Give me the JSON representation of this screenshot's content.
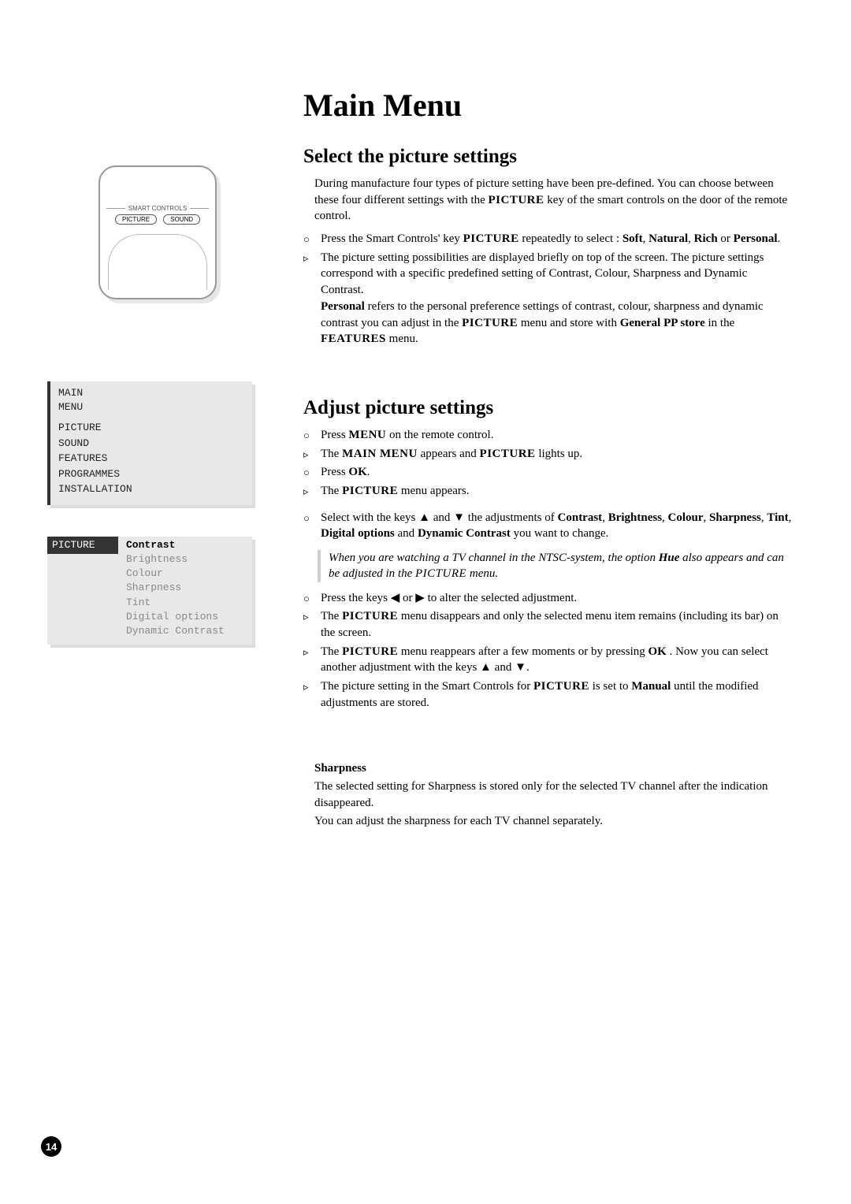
{
  "page_number": "14",
  "title": "Main Menu",
  "remote": {
    "smart_controls_label": "SMART CONTROLS",
    "btn_picture": "PICTURE",
    "btn_sound": "SOUND"
  },
  "osd_main": {
    "title_line1": "MAIN",
    "title_line2": "MENU",
    "items": [
      "PICTURE",
      "SOUND",
      "FEATURES",
      "PROGRAMMES",
      "INSTALLATION"
    ]
  },
  "osd_picture": {
    "left_label": "PICTURE",
    "items": [
      "Contrast",
      "Brightness",
      "Colour",
      "Sharpness",
      "Tint",
      "Digital options",
      "Dynamic Contrast"
    ]
  },
  "sec1": {
    "heading": "Select the picture settings",
    "intro": "During manufacture four types of picture setting have been pre-defined. You can choose between these four different settings with the ",
    "intro_key": "PICTURE",
    "intro_end": " key of the smart controls on the door of the remote control.",
    "b1_a": "Press the Smart Controls' key ",
    "b1_key": "PICTURE",
    "b1_b": " repeatedly to select :  ",
    "b1_soft": "Soft",
    "b1_sep1": ", ",
    "b1_nat": "Natural",
    "b1_sep2": ", ",
    "b1_rich": "Rich",
    "b1_or": " or ",
    "b1_pers": "Personal",
    "b1_end": ".",
    "b2": "The picture setting possibilities are displayed briefly on top of the screen. The picture settings correspond with a specific predefined setting of Contrast, Colour, Sharpness and Dynamic Contrast.",
    "b2b_pers": "Personal",
    "b2b_rest": " refers to the personal preference settings of contrast, colour, sharpness and dynamic contrast you can adjust in the ",
    "b2b_key": "PICTURE",
    "b2b_mid": " menu and store with ",
    "b2b_gpp": "General PP store",
    "b2b_in": " in the ",
    "b2b_feat": "FEATURES",
    "b2b_end": " menu."
  },
  "sec2": {
    "heading": "Adjust picture settings",
    "s1a": "Press ",
    "s1_menu": "MENU",
    "s1b": " on the remote control.",
    "s2a": "The ",
    "s2_mm": "MAIN MENU",
    "s2b": " appears and ",
    "s2_pic": "PICTURE",
    "s2c": " lights up.",
    "s3a": "Press ",
    "s3_ok": "OK",
    "s3b": ".",
    "s4a": "The ",
    "s4_pic": "PICTURE",
    "s4b": " menu appears.",
    "s5a": "Select with the keys ",
    "s5_up": "▲",
    "s5_and": " and ",
    "s5_dn": "▼",
    "s5b": " the adjustments of ",
    "s5_con": "Contrast",
    "s5_c1": ", ",
    "s5_bri": "Brightness",
    "s5_c2": ", ",
    "s5_col": "Colour",
    "s5_c3": ", ",
    "s5_sha": "Sharpness",
    "s5_c4": ", ",
    "s5_tin": "Tint",
    "s5_c5": ", ",
    "s5_dig": "Digital options",
    "s5_c6": " and ",
    "s5_dyn": "Dynamic Contrast",
    "s5c": " you want to change.",
    "note_a": "When you are watching a TV channel in the NTSC-system, the option ",
    "note_hue": "Hue",
    "note_b": " also appears and can be adjusted in the ",
    "note_pic": "PICTURE",
    "note_c": " menu.",
    "s6a": "Press the keys ",
    "s6_l": "◀",
    "s6_or": " or ",
    "s6_r": "▶",
    "s6b": " to alter the selected adjustment.",
    "s7a": "The ",
    "s7_pic": "PICTURE",
    "s7b": " menu disappears and only the selected menu item remains (including its bar) on the screen.",
    "s8a": "The ",
    "s8_pic": "PICTURE",
    "s8b": " menu reappears after a few moments or by pressing ",
    "s8_ok": "OK",
    "s8c": " . Now you can select another adjustment with the keys ",
    "s8_up": "▲",
    "s8_and": " and ",
    "s8_dn": "▼",
    "s8d": ".",
    "s9a": "The picture setting in the Smart Controls for ",
    "s9_pic": "PICTURE",
    "s9b": " is set to ",
    "s9_man": "Manual",
    "s9c": " until the modified adjustments are stored."
  },
  "sharp": {
    "heading": "Sharpness",
    "p1": "The selected setting for Sharpness is stored only for the selected TV channel after the indication disappeared.",
    "p2": "You can adjust the sharpness for each TV channel separately."
  }
}
